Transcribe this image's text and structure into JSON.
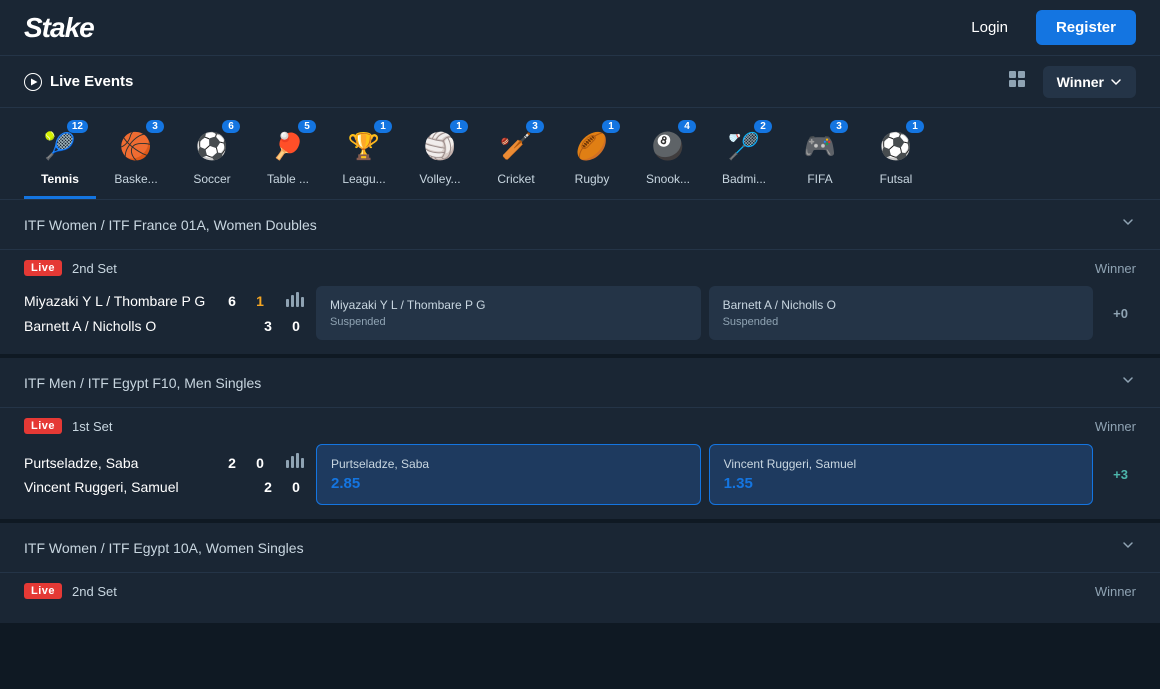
{
  "header": {
    "logo": "Stake",
    "login_label": "Login",
    "register_label": "Register"
  },
  "live_events_bar": {
    "title": "Live Events",
    "winner_label": "Winner"
  },
  "sports": [
    {
      "id": "tennis",
      "label": "Tennis",
      "emoji": "🎾",
      "badge": "12",
      "active": true
    },
    {
      "id": "basketball",
      "label": "Baske...",
      "emoji": "🏀",
      "badge": "3",
      "active": false
    },
    {
      "id": "soccer",
      "label": "Soccer",
      "emoji": "⚽",
      "badge": "6",
      "active": false
    },
    {
      "id": "table",
      "label": "Table ...",
      "emoji": "🏓",
      "badge": "5",
      "active": false
    },
    {
      "id": "league",
      "label": "Leagu...",
      "emoji": "🏆",
      "badge": "1",
      "active": false
    },
    {
      "id": "volleyball",
      "label": "Volley...",
      "emoji": "🏐",
      "badge": "1",
      "active": false
    },
    {
      "id": "cricket",
      "label": "Cricket",
      "emoji": "🏏",
      "badge": "3",
      "active": false
    },
    {
      "id": "rugby",
      "label": "Rugby",
      "emoji": "🏉",
      "badge": "1",
      "active": false
    },
    {
      "id": "snooker",
      "label": "Snook...",
      "emoji": "🎱",
      "badge": "4",
      "active": false
    },
    {
      "id": "badminton",
      "label": "Badmi...",
      "emoji": "🏸",
      "badge": "2",
      "active": false
    },
    {
      "id": "fifa",
      "label": "FIFA",
      "emoji": "🎮",
      "badge": "3",
      "active": false
    },
    {
      "id": "futsal",
      "label": "Futsal",
      "emoji": "⚽",
      "badge": "1",
      "active": false
    }
  ],
  "match_groups": [
    {
      "id": "group1",
      "title": "ITF Women / ITF France 01A, Women Doubles",
      "matches": [
        {
          "live_badge": "Live",
          "period": "2nd Set",
          "market_label": "Winner",
          "teams": [
            {
              "name": "Miyazaki Y L / Thombare P G",
              "score1": "6",
              "score2": "1",
              "score2_highlight": true
            },
            {
              "name": "Barnett A / Nicholls O",
              "score1": "3",
              "score2": "0",
              "score2_highlight": false
            }
          ],
          "bet_options": [
            {
              "team": "Miyazaki Y L / Thombare P G",
              "sub": "Suspended",
              "odds": null,
              "active": false
            },
            {
              "team": "Barnett A / Nicholls O",
              "sub": "Suspended",
              "odds": null,
              "active": false
            }
          ],
          "more_bets": "+0"
        }
      ]
    },
    {
      "id": "group2",
      "title": "ITF Men / ITF Egypt F10, Men Singles",
      "matches": [
        {
          "live_badge": "Live",
          "period": "1st Set",
          "market_label": "Winner",
          "teams": [
            {
              "name": "Purtseladze, Saba",
              "score1": "2",
              "score2": "0",
              "score2_highlight": false
            },
            {
              "name": "Vincent Ruggeri, Samuel",
              "score1": "2",
              "score2": "0",
              "score2_highlight": false
            }
          ],
          "bet_options": [
            {
              "team": "Purtseladze, Saba",
              "odds": "2.85",
              "active": true
            },
            {
              "team": "Vincent Ruggeri, Samuel",
              "odds": "1.35",
              "active": true
            }
          ],
          "more_bets": "+3"
        }
      ]
    },
    {
      "id": "group3",
      "title": "ITF Women / ITF Egypt 10A, Women Singles",
      "matches": [
        {
          "live_badge": "Live",
          "period": "2nd Set",
          "market_label": "Winner",
          "teams": [],
          "bet_options": [],
          "more_bets": ""
        }
      ]
    }
  ]
}
